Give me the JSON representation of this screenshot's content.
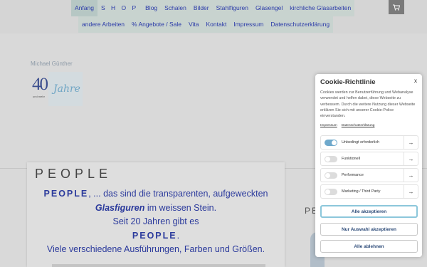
{
  "nav": {
    "row1": [
      "Anfang",
      "S H O P",
      "Blog",
      "Schalen",
      "Bilder",
      "Stahlfiguren",
      "Glasengel",
      "kirchliche Glasarbeiten"
    ],
    "row2": [
      "andere Arbeiten",
      "% Angebote / Sale",
      "Vita",
      "Kontakt",
      "Impressum",
      "Datenschutzerklärung"
    ],
    "active": "Anfang",
    "cart_icon": "cart-icon"
  },
  "logo": {
    "name": "Michael Günther",
    "number": "40",
    "word": "Jahre",
    "small": "und mehr"
  },
  "card": {
    "title": "PEOPLE",
    "line1_bold": "PEOPLE",
    "line1_rest": ",    ... das sind die transparenten, aufgeweckten",
    "line2_italic": "Glasfiguren",
    "line2_rest": " im weissen Stein.",
    "line3": "Seit 20 Jahren gibt es",
    "line4_bold": "PEOPLE",
    "line4_rest": ".",
    "line5": "Viele verschiedene Ausführungen, Farben und Größen."
  },
  "right_title": "PE",
  "cookie": {
    "title": "Cookie-Richtlinie",
    "close": "x",
    "text": "Cookies werden zur Benutzerführung und Webanalyse verwendet und helfen dabei, diese Webseite zu verbessern. Durch die weitere Nutzung dieser Webseite erklären Sie sich mit unserer Cookie-Police einverstanden.",
    "link_impressum": "Impressum",
    "link_datenschutz": "Datenschutzerklärung",
    "rows": [
      {
        "label": "Unbedingt erforderlich",
        "on": true
      },
      {
        "label": "Funktionell",
        "on": false
      },
      {
        "label": "Performance",
        "on": false
      },
      {
        "label": "Marketing / Third Party",
        "on": false
      }
    ],
    "btn_accept_all": "Alle akzeptieren",
    "btn_accept_selection": "Nur Auswahl akzeptieren",
    "btn_reject": "Alle ablehnen",
    "accent_color": "#6fa9cc"
  }
}
